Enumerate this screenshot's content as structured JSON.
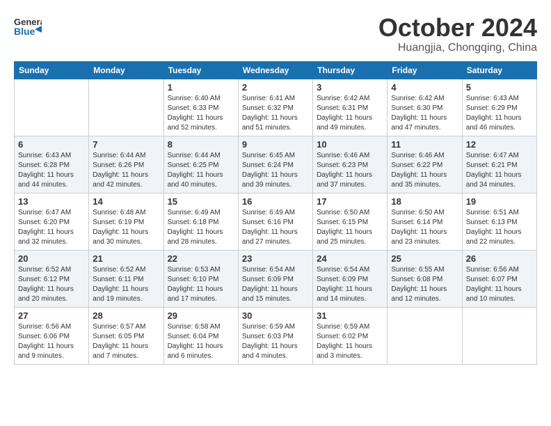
{
  "logo": {
    "line1": "General",
    "line2": "Blue",
    "arrow_color": "#1a6faf"
  },
  "title": "October 2024",
  "location": "Huangjia, Chongqing, China",
  "days_of_week": [
    "Sunday",
    "Monday",
    "Tuesday",
    "Wednesday",
    "Thursday",
    "Friday",
    "Saturday"
  ],
  "weeks": [
    [
      {
        "day": "",
        "info": ""
      },
      {
        "day": "",
        "info": ""
      },
      {
        "day": "1",
        "info": "Sunrise: 6:40 AM\nSunset: 6:33 PM\nDaylight: 11 hours and 52 minutes."
      },
      {
        "day": "2",
        "info": "Sunrise: 6:41 AM\nSunset: 6:32 PM\nDaylight: 11 hours and 51 minutes."
      },
      {
        "day": "3",
        "info": "Sunrise: 6:42 AM\nSunset: 6:31 PM\nDaylight: 11 hours and 49 minutes."
      },
      {
        "day": "4",
        "info": "Sunrise: 6:42 AM\nSunset: 6:30 PM\nDaylight: 11 hours and 47 minutes."
      },
      {
        "day": "5",
        "info": "Sunrise: 6:43 AM\nSunset: 6:29 PM\nDaylight: 11 hours and 46 minutes."
      }
    ],
    [
      {
        "day": "6",
        "info": "Sunrise: 6:43 AM\nSunset: 6:28 PM\nDaylight: 11 hours and 44 minutes."
      },
      {
        "day": "7",
        "info": "Sunrise: 6:44 AM\nSunset: 6:26 PM\nDaylight: 11 hours and 42 minutes."
      },
      {
        "day": "8",
        "info": "Sunrise: 6:44 AM\nSunset: 6:25 PM\nDaylight: 11 hours and 40 minutes."
      },
      {
        "day": "9",
        "info": "Sunrise: 6:45 AM\nSunset: 6:24 PM\nDaylight: 11 hours and 39 minutes."
      },
      {
        "day": "10",
        "info": "Sunrise: 6:46 AM\nSunset: 6:23 PM\nDaylight: 11 hours and 37 minutes."
      },
      {
        "day": "11",
        "info": "Sunrise: 6:46 AM\nSunset: 6:22 PM\nDaylight: 11 hours and 35 minutes."
      },
      {
        "day": "12",
        "info": "Sunrise: 6:47 AM\nSunset: 6:21 PM\nDaylight: 11 hours and 34 minutes."
      }
    ],
    [
      {
        "day": "13",
        "info": "Sunrise: 6:47 AM\nSunset: 6:20 PM\nDaylight: 11 hours and 32 minutes."
      },
      {
        "day": "14",
        "info": "Sunrise: 6:48 AM\nSunset: 6:19 PM\nDaylight: 11 hours and 30 minutes."
      },
      {
        "day": "15",
        "info": "Sunrise: 6:49 AM\nSunset: 6:18 PM\nDaylight: 11 hours and 28 minutes."
      },
      {
        "day": "16",
        "info": "Sunrise: 6:49 AM\nSunset: 6:16 PM\nDaylight: 11 hours and 27 minutes."
      },
      {
        "day": "17",
        "info": "Sunrise: 6:50 AM\nSunset: 6:15 PM\nDaylight: 11 hours and 25 minutes."
      },
      {
        "day": "18",
        "info": "Sunrise: 6:50 AM\nSunset: 6:14 PM\nDaylight: 11 hours and 23 minutes."
      },
      {
        "day": "19",
        "info": "Sunrise: 6:51 AM\nSunset: 6:13 PM\nDaylight: 11 hours and 22 minutes."
      }
    ],
    [
      {
        "day": "20",
        "info": "Sunrise: 6:52 AM\nSunset: 6:12 PM\nDaylight: 11 hours and 20 minutes."
      },
      {
        "day": "21",
        "info": "Sunrise: 6:52 AM\nSunset: 6:11 PM\nDaylight: 11 hours and 19 minutes."
      },
      {
        "day": "22",
        "info": "Sunrise: 6:53 AM\nSunset: 6:10 PM\nDaylight: 11 hours and 17 minutes."
      },
      {
        "day": "23",
        "info": "Sunrise: 6:54 AM\nSunset: 6:09 PM\nDaylight: 11 hours and 15 minutes."
      },
      {
        "day": "24",
        "info": "Sunrise: 6:54 AM\nSunset: 6:09 PM\nDaylight: 11 hours and 14 minutes."
      },
      {
        "day": "25",
        "info": "Sunrise: 6:55 AM\nSunset: 6:08 PM\nDaylight: 11 hours and 12 minutes."
      },
      {
        "day": "26",
        "info": "Sunrise: 6:56 AM\nSunset: 6:07 PM\nDaylight: 11 hours and 10 minutes."
      }
    ],
    [
      {
        "day": "27",
        "info": "Sunrise: 6:56 AM\nSunset: 6:06 PM\nDaylight: 11 hours and 9 minutes."
      },
      {
        "day": "28",
        "info": "Sunrise: 6:57 AM\nSunset: 6:05 PM\nDaylight: 11 hours and 7 minutes."
      },
      {
        "day": "29",
        "info": "Sunrise: 6:58 AM\nSunset: 6:04 PM\nDaylight: 11 hours and 6 minutes."
      },
      {
        "day": "30",
        "info": "Sunrise: 6:59 AM\nSunset: 6:03 PM\nDaylight: 11 hours and 4 minutes."
      },
      {
        "day": "31",
        "info": "Sunrise: 6:59 AM\nSunset: 6:02 PM\nDaylight: 11 hours and 3 minutes."
      },
      {
        "day": "",
        "info": ""
      },
      {
        "day": "",
        "info": ""
      }
    ]
  ]
}
